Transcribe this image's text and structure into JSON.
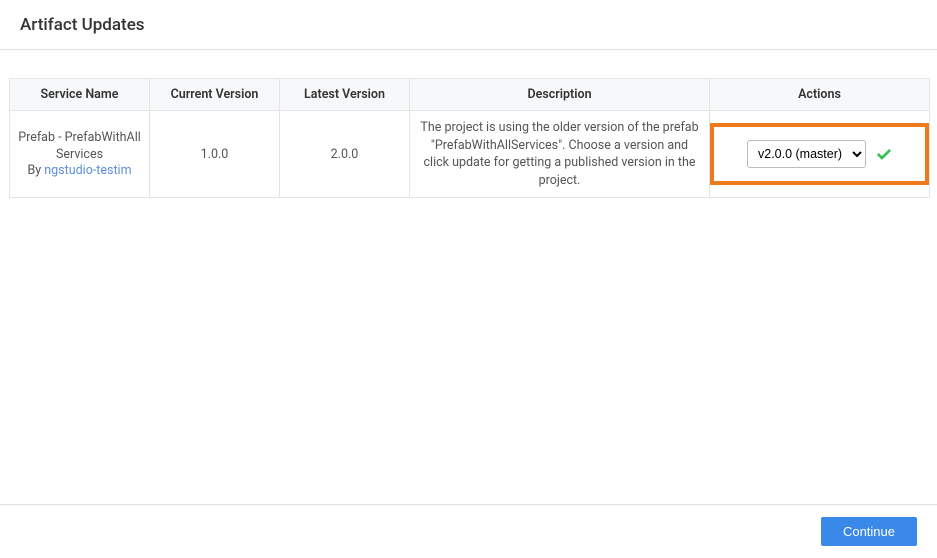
{
  "header": {
    "title": "Artifact Updates"
  },
  "table": {
    "columns": {
      "service_name": "Service Name",
      "current_version": "Current Version",
      "latest_version": "Latest Version",
      "description": "Description",
      "actions": "Actions"
    },
    "rows": [
      {
        "service_name_line1": "Prefab - PrefabWithAll",
        "service_name_line2": "Services",
        "by_label": "By ",
        "author": "ngstudio-testim",
        "current_version": "1.0.0",
        "latest_version": "2.0.0",
        "description": "The project is using the older version of the prefab \"PrefabWithAllServices\". Choose a version and click update for getting a published version in the project.",
        "actions": {
          "selected_version": "v2.0.0 (master)",
          "highlight_color": "#f07a1a",
          "check_color": "#2fc24c"
        }
      }
    ]
  },
  "footer": {
    "continue_label": "Continue"
  }
}
